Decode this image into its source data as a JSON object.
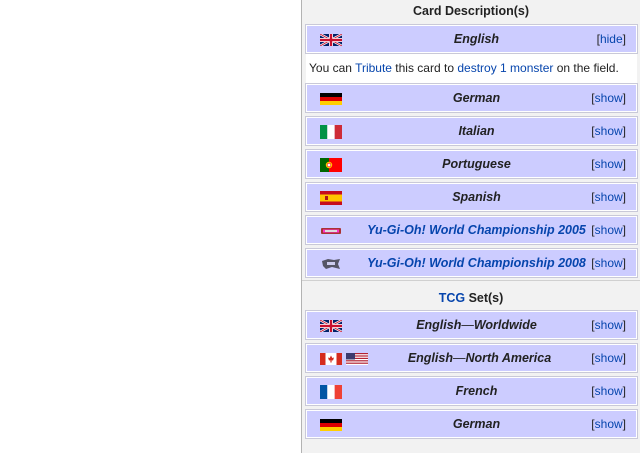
{
  "card_descriptions": {
    "title": "Card Description(s)",
    "rows": [
      {
        "language": "English",
        "toggle": "hide",
        "flag": "uk-flag-icon"
      },
      {
        "language": "German",
        "toggle": "show",
        "flag": "germany-flag-icon"
      },
      {
        "language": "Italian",
        "toggle": "show",
        "flag": "italy-flag-icon"
      },
      {
        "language": "Portuguese",
        "toggle": "show",
        "flag": "portugal-flag-icon"
      },
      {
        "language": "Spanish",
        "toggle": "show",
        "flag": "spain-flag-icon"
      },
      {
        "language": "Yu-Gi-Oh! World Championship 2005",
        "toggle": "show",
        "flag": "wc2005-logo-icon"
      },
      {
        "language": "Yu-Gi-Oh! World Championship 2008",
        "toggle": "show",
        "flag": "wc2008-logo-icon"
      }
    ],
    "english_text": {
      "before": "You can ",
      "link1": "Tribute",
      "middle": " this card to ",
      "link2": "destroy",
      "space": " ",
      "link3": "1 monster",
      "after": " on the field."
    }
  },
  "tcg_sets": {
    "title_link": "TCG",
    "title_rest": " Set(s)",
    "rows": [
      {
        "prefix": "English",
        "dash": "—",
        "suffix": "Worldwide",
        "toggle": "show"
      },
      {
        "prefix": "English",
        "dash": "—",
        "suffix": "North America",
        "toggle": "show"
      },
      {
        "prefix": "French",
        "dash": "",
        "suffix": "",
        "toggle": "show"
      },
      {
        "prefix": "German",
        "dash": "",
        "suffix": "",
        "toggle": "show"
      }
    ]
  },
  "toggle_brackets": {
    "open": "[",
    "close": "]"
  },
  "colors": {
    "header_bg": "#ccccff",
    "link": "#0645ad",
    "panel_bg": "#f2f2f2"
  }
}
